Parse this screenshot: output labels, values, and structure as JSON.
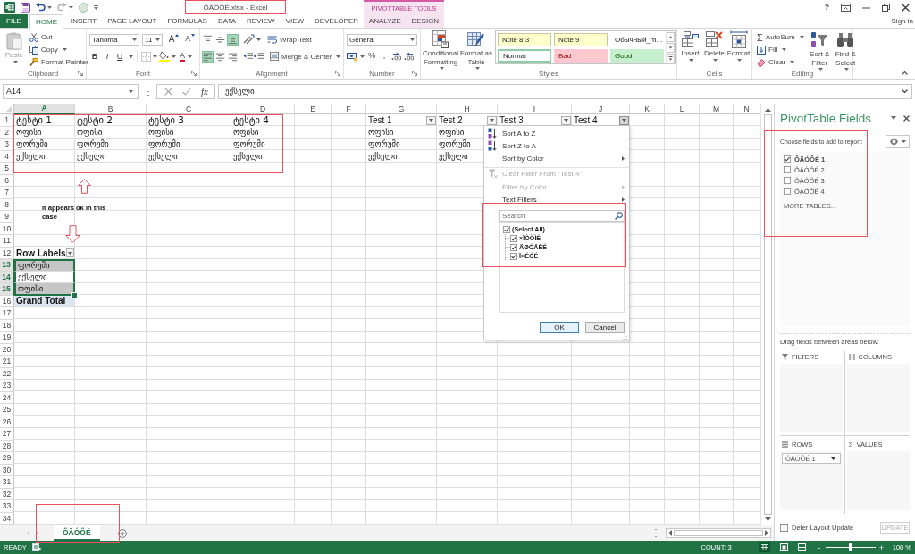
{
  "window": {
    "title": "ÔÄÓÔÉ.xlsx - Excel",
    "contextual_tab_group": "PIVOTTABLE TOOLS",
    "help": "?",
    "sign_in": "Sign in"
  },
  "tabs": [
    {
      "label": "FILE",
      "kind": "file",
      "selected": false
    },
    {
      "label": "HOME",
      "kind": "main",
      "selected": true
    },
    {
      "label": "INSERT",
      "kind": "main",
      "selected": false
    },
    {
      "label": "PAGE LAYOUT",
      "kind": "main",
      "selected": false
    },
    {
      "label": "FORMULAS",
      "kind": "main",
      "selected": false
    },
    {
      "label": "DATA",
      "kind": "main",
      "selected": false
    },
    {
      "label": "REVIEW",
      "kind": "main",
      "selected": false
    },
    {
      "label": "VIEW",
      "kind": "main",
      "selected": false
    },
    {
      "label": "DEVELOPER",
      "kind": "main",
      "selected": false
    },
    {
      "label": "ANALYZE",
      "kind": "contextual",
      "selected": false
    },
    {
      "label": "DESIGN",
      "kind": "contextual",
      "selected": false
    }
  ],
  "clipboard": {
    "label": "Clipboard",
    "paste": {
      "label": "Paste",
      "disabled": true
    },
    "cut": "Cut",
    "copy": "Copy",
    "format_painter": "Format Painter"
  },
  "font": {
    "label": "Font",
    "font_name": "Tahoma",
    "font_size": "11",
    "grow": "A",
    "shrink": "A",
    "styles": [
      {
        "label": "B",
        "kind": "bold"
      },
      {
        "label": "I",
        "kind": "italic"
      },
      {
        "label": "U",
        "kind": "underline"
      }
    ],
    "font_color": "A"
  },
  "alignment": {
    "label": "Alignment",
    "vertical": [
      {
        "kind": "top",
        "selected": false
      },
      {
        "kind": "middle",
        "selected": false
      },
      {
        "kind": "bottom",
        "selected": true
      }
    ],
    "horizontal": [
      {
        "kind": "left",
        "selected": true
      },
      {
        "kind": "center",
        "selected": false
      },
      {
        "kind": "right",
        "selected": false
      }
    ],
    "wrap_text": "Wrap Text",
    "merge": "Merge & Center"
  },
  "number": {
    "label": "Number",
    "format": "General",
    "percent": "%",
    "comma": ","
  },
  "styles": {
    "label": "Styles",
    "conditional_formatting": [
      "Conditional",
      "Formatting"
    ],
    "format_as_table": [
      "Format as",
      "Table"
    ],
    "gallery": [
      {
        "label": "Note 8 3",
        "kind": "note",
        "selected": false
      },
      {
        "label": "Note 9",
        "kind": "note",
        "selected": false
      },
      {
        "label": "Обычный_m...",
        "kind": "plain",
        "selected": false
      },
      {
        "label": "Normal",
        "kind": "plain",
        "selected": true
      },
      {
        "label": "Bad",
        "kind": "bad",
        "selected": false
      },
      {
        "label": "Good",
        "kind": "good",
        "selected": false
      }
    ]
  },
  "cells": {
    "label": "Cells",
    "buttons": [
      {
        "label": "Insert",
        "kind": "insert"
      },
      {
        "label": "Delete",
        "kind": "delete"
      },
      {
        "label": "Format",
        "kind": "format"
      }
    ]
  },
  "editing": {
    "label": "Editing",
    "autosum_symbol": "Σ",
    "autosum": "AutoSum",
    "fill": "Fill",
    "clear": "Clear",
    "sort_filter": [
      "Sort &",
      "Filter"
    ],
    "find_select": [
      "Find &",
      "Select"
    ]
  },
  "formula_bar": {
    "name_box": "A14",
    "function_label": "fx",
    "value": "ექსელი"
  },
  "columns": [
    {
      "label": "A",
      "selected": true
    },
    {
      "label": "B",
      "selected": false
    },
    {
      "label": "C",
      "selected": false
    },
    {
      "label": "D",
      "selected": false
    },
    {
      "label": "E",
      "selected": false
    },
    {
      "label": "F",
      "selected": false
    },
    {
      "label": "G",
      "selected": false
    },
    {
      "label": "H",
      "selected": false
    },
    {
      "label": "I",
      "selected": false
    },
    {
      "label": "J",
      "selected": false
    },
    {
      "label": "K",
      "selected": false
    },
    {
      "label": "L",
      "selected": false
    },
    {
      "label": "M",
      "selected": false
    },
    {
      "label": "N",
      "selected": false
    }
  ],
  "row_headers": [
    {
      "label": "1",
      "selected": false
    },
    {
      "label": "2",
      "selected": false
    },
    {
      "label": "3",
      "selected": false
    },
    {
      "label": "4",
      "selected": false
    },
    {
      "label": "5",
      "selected": false
    },
    {
      "label": "6",
      "selected": false
    },
    {
      "label": "7",
      "selected": false
    },
    {
      "label": "8",
      "selected": false
    },
    {
      "label": "9",
      "selected": false
    },
    {
      "label": "10",
      "selected": false
    },
    {
      "label": "11",
      "selected": false
    },
    {
      "label": "12",
      "selected": false
    },
    {
      "label": "13",
      "selected": true
    },
    {
      "label": "14",
      "selected": true
    },
    {
      "label": "15",
      "selected": true
    },
    {
      "label": "16",
      "selected": false
    },
    {
      "label": "17",
      "selected": false
    },
    {
      "label": "18",
      "selected": false
    },
    {
      "label": "19",
      "selected": false
    },
    {
      "label": "20",
      "selected": false
    },
    {
      "label": "21",
      "selected": false
    },
    {
      "label": "22",
      "selected": false
    },
    {
      "label": "23",
      "selected": false
    },
    {
      "label": "24",
      "selected": false
    },
    {
      "label": "25",
      "selected": false
    },
    {
      "label": "26",
      "selected": false
    },
    {
      "label": "27",
      "selected": false
    },
    {
      "label": "28",
      "selected": false
    },
    {
      "label": "29",
      "selected": false
    },
    {
      "label": "30",
      "selected": false
    },
    {
      "label": "31",
      "selected": false
    },
    {
      "label": "32",
      "selected": false
    },
    {
      "label": "33",
      "selected": false
    },
    {
      "label": "34",
      "selected": false
    }
  ],
  "source_range": {
    "headers": [
      "ტესტი 1",
      "ტესტი 2",
      "ტესტი 3",
      "ტესტი 4"
    ],
    "rows": [
      [
        "ოფისი",
        "ოფისი",
        "ოფისი",
        "ოფისი"
      ],
      [
        "ფორუმი",
        "ფორუმი",
        "ფორუმი",
        "ფორუმი"
      ],
      [
        "ექსელი",
        "ექსელი",
        "ექსელი",
        "ექსელი"
      ]
    ]
  },
  "filter_range": {
    "headers": [
      {
        "label": "Test 1",
        "filter_open": false
      },
      {
        "label": "Test 2",
        "filter_open": false
      },
      {
        "label": "Test 3",
        "filter_open": false
      },
      {
        "label": "Test 4",
        "filter_open": true
      }
    ],
    "rows": [
      [
        "ოფისი",
        "ოფისი"
      ],
      [
        "ფორუმი",
        "ფორუმი"
      ],
      [
        "ექსელი",
        "ექსელი"
      ]
    ]
  },
  "note": "It appears ok in this case",
  "pivot_table": {
    "header": "Row Labels",
    "items": [
      {
        "label": "ფორუმი",
        "selected": true,
        "active": false
      },
      {
        "label": "ექსელი",
        "selected": true,
        "active": true
      },
      {
        "label": "ოფისი",
        "selected": true,
        "active": false
      }
    ],
    "grand_total": "Grand Total"
  },
  "filter_menu": {
    "commands": [
      {
        "label": "Sort A to Z",
        "kind": "sort_asc",
        "disabled": false,
        "submenu": false
      },
      {
        "label": "Sort Z to A",
        "kind": "sort_desc",
        "disabled": false,
        "submenu": false
      },
      {
        "label": "Sort by Color",
        "kind": "sort_color",
        "disabled": false,
        "submenu": true
      },
      {
        "label": "Clear Filter From \"Test 4\"",
        "kind": "clear",
        "disabled": true,
        "submenu": false
      },
      {
        "label": "Filter by Color",
        "kind": "filter_color",
        "disabled": true,
        "submenu": true
      },
      {
        "label": "Text Filters",
        "kind": "text_filters",
        "disabled": false,
        "submenu": true
      }
    ],
    "search": {
      "placeholder": "Search"
    },
    "values": [
      {
        "label": "(Select All)",
        "kind": "all",
        "checked": true
      },
      {
        "label": "×ÏÒÖÌÉ",
        "kind": "value",
        "checked": true
      },
      {
        "label": "ÄØÓÄËÉ",
        "kind": "value",
        "checked": true
      },
      {
        "label": "Ï×ÉÓÉ",
        "kind": "value",
        "checked": true
      }
    ],
    "ok": "OK",
    "cancel": "Cancel"
  },
  "pivot_fields": {
    "title": "PivotTable Fields",
    "subtitle": "Choose fields to add to report:",
    "fields": [
      {
        "label": "ÔÄÓÔÉ 1",
        "checked": true
      },
      {
        "label": "ÔÄÓÔÉ 2",
        "checked": false
      },
      {
        "label": "ÔÄÓÔÉ 3",
        "checked": false
      },
      {
        "label": "ÔÄÓÔÉ 4",
        "checked": false
      }
    ],
    "more_tables": "MORE TABLES...",
    "areas_hint": "Drag fields between areas below:",
    "areas": [
      {
        "label": "FILTERS",
        "kind": "filters"
      },
      {
        "label": "COLUMNS",
        "kind": "columns"
      },
      {
        "label": "ROWS",
        "kind": "rows",
        "fields": [
          "ÔÄÓÔÉ 1"
        ]
      },
      {
        "label": "VALUES",
        "kind": "values",
        "symbol": "Σ"
      }
    ],
    "defer": {
      "label": "Defer Layout Update",
      "checked": false
    },
    "update": {
      "label": "UPDATE",
      "disabled": true
    }
  },
  "sheet_tabs": [
    {
      "label": "ÔÄÓÔÉ",
      "selected": true
    }
  ],
  "status_bar": {
    "mode": "READY",
    "count": "COUNT: 3",
    "zoom_out": "-",
    "zoom_in": "+",
    "zoom": "100 %",
    "zoom_slider": {
      "level": 0.5
    }
  }
}
